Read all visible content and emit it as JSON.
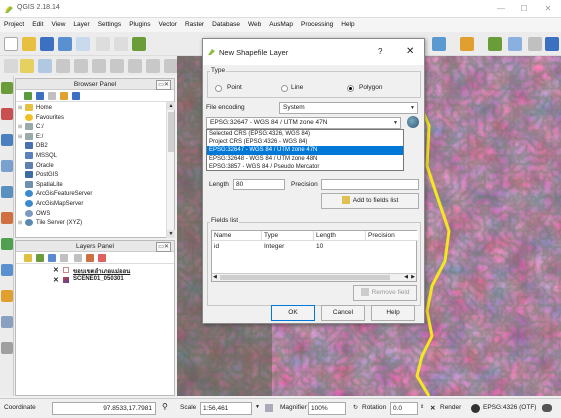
{
  "app": {
    "title": "QGIS 2.18.14"
  },
  "menu": [
    "Project",
    "Edit",
    "View",
    "Layer",
    "Settings",
    "Plugins",
    "Vector",
    "Raster",
    "Database",
    "Web",
    "AusMap",
    "Processing",
    "Help"
  ],
  "browser_panel": {
    "title": "Browser Panel",
    "items": [
      {
        "label": "Home",
        "expandable": true,
        "icon": "home-folder-icon"
      },
      {
        "label": "Favourites",
        "expandable": false,
        "icon": "star-icon"
      },
      {
        "label": "C:/",
        "expandable": true,
        "icon": "drive-icon"
      },
      {
        "label": "E:/",
        "expandable": true,
        "icon": "drive-icon"
      },
      {
        "label": "DB2",
        "expandable": false,
        "icon": "database-icon"
      },
      {
        "label": "MSSQL",
        "expandable": false,
        "icon": "database-icon"
      },
      {
        "label": "Oracle",
        "expandable": false,
        "icon": "database-icon"
      },
      {
        "label": "PostGIS",
        "expandable": false,
        "icon": "elephant-icon"
      },
      {
        "label": "SpatiaLite",
        "expandable": false,
        "icon": "feather-icon"
      },
      {
        "label": "ArcGisFeatureServer",
        "expandable": false,
        "icon": "arcgis-icon"
      },
      {
        "label": "ArcGisMapServer",
        "expandable": false,
        "icon": "arcgis-icon"
      },
      {
        "label": "OWS",
        "expandable": false,
        "icon": "globe-icon"
      },
      {
        "label": "Tile Server (XYZ)",
        "expandable": true,
        "icon": "globe-icon"
      }
    ]
  },
  "layers_panel": {
    "title": "Layers Panel",
    "layers": [
      {
        "label": "ขอบเขตอำเภอแม่ออน",
        "checked": true
      },
      {
        "label": "SCENE01_050301",
        "checked": true
      }
    ]
  },
  "dialog": {
    "title": "New Shapefile Layer",
    "help_glyph": "?",
    "type_group_label": "Type",
    "type_options": [
      {
        "label": "Point",
        "selected": false
      },
      {
        "label": "Line",
        "selected": false
      },
      {
        "label": "Polygon",
        "selected": true
      }
    ],
    "encoding_label": "File encoding",
    "encoding_value": "System",
    "crs_value": "EPSG:32647 - WGS 84 / UTM zone 47N",
    "crs_options": [
      {
        "label": "Selected CRS (EPSG:4326, WGS 84)",
        "selected": false
      },
      {
        "label": "Project CRS (EPSG:4326 - WGS 84)",
        "selected": false
      },
      {
        "label": "EPSG:32647 - WGS 84 / UTM zone 47N",
        "selected": true
      },
      {
        "label": "EPSG:32648 - WGS 84 / UTM zone 48N",
        "selected": false
      },
      {
        "label": "EPSG:3857 - WGS 84 / Pseudo Mercator",
        "selected": false
      }
    ],
    "length_label": "Length",
    "length_value": "80",
    "precision_label": "Precision",
    "precision_value": "",
    "add_field_button": "Add to fields list",
    "fields_group_label": "Fields list",
    "fields_headers": [
      "Name",
      "Type",
      "Length",
      "Precision"
    ],
    "fields_rows": [
      {
        "name": "id",
        "type": "Integer",
        "length": "10",
        "precision": ""
      }
    ],
    "remove_field_button": "Remove field",
    "ok_button": "OK",
    "cancel_button": "Cancel",
    "help_button": "Help"
  },
  "status": {
    "coordinate_label": "Coordinate",
    "coordinate_value": "97.8533,17.7981",
    "scale_label": "Scale",
    "scale_value": "1:56,461",
    "magnifier_label": "Magnifier",
    "magnifier_value": "100%",
    "rotation_label": "Rotation",
    "rotation_value": "0.0",
    "render_label": "Render",
    "crs_label": "EPSG:4326 (OTF)"
  },
  "colors": {
    "accent": "#0078d7",
    "map_terrain": "#9a3050",
    "boundary_line": "#f5e61e"
  }
}
